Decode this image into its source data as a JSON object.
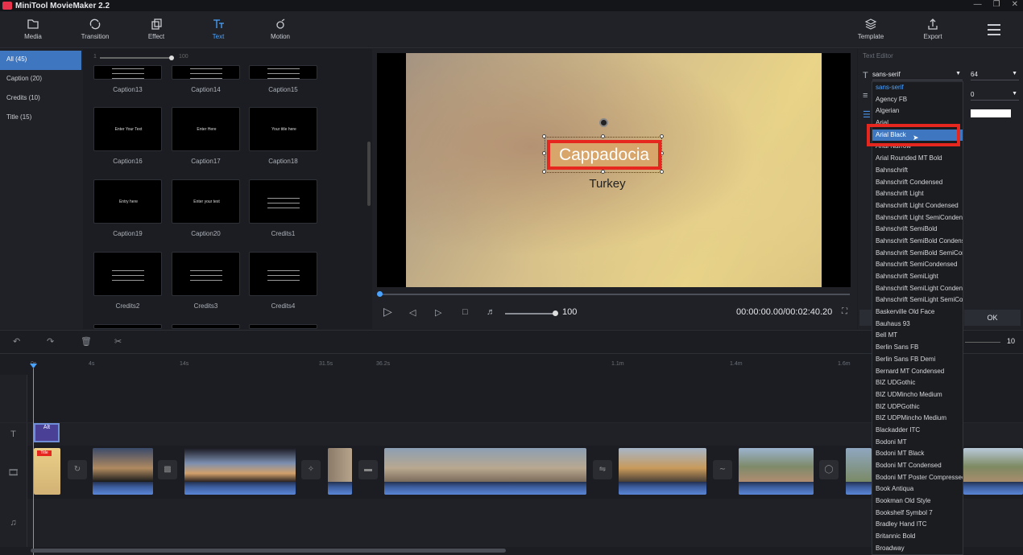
{
  "app": {
    "title": "MiniTool MovieMaker 2.2"
  },
  "toolbar": [
    {
      "label": "Media",
      "icon": "folder-icon"
    },
    {
      "label": "Transition",
      "icon": "transition-icon"
    },
    {
      "label": "Effect",
      "icon": "effect-icon"
    },
    {
      "label": "Text",
      "icon": "text-icon",
      "active": true
    },
    {
      "label": "Motion",
      "icon": "motion-icon"
    }
  ],
  "toolbar_right": [
    {
      "label": "Template",
      "icon": "template-icon"
    },
    {
      "label": "Export",
      "icon": "export-icon"
    }
  ],
  "categories": [
    {
      "label": "All (45)",
      "active": true
    },
    {
      "label": "Caption (20)"
    },
    {
      "label": "Credits (10)"
    },
    {
      "label": "Title (15)"
    }
  ],
  "library": {
    "slider_min": "1",
    "slider_max": "100",
    "rows": [
      [
        "Caption13",
        "Caption14",
        "Caption15"
      ],
      [
        "Caption16",
        "Caption17",
        "Caption18"
      ],
      [
        "Caption19",
        "Caption20",
        "Credits1"
      ],
      [
        "Credits2",
        "Credits3",
        "Credits4"
      ]
    ],
    "thumb_texts": [
      [
        "",
        "",
        ""
      ],
      [
        "Enter Your Text",
        "Enter Here",
        "Your title here"
      ],
      [
        "Entry here",
        "Enter your text",
        ""
      ],
      [
        "",
        "",
        ""
      ]
    ]
  },
  "preview": {
    "caption_text": "Cappadocia",
    "subtitle_text": "Turkey",
    "volume": "100",
    "timecode": "00:00:00.00/00:02:40.20"
  },
  "text_editor": {
    "title": "Text Editor",
    "font_value": "sans-serif",
    "size_value": "64",
    "spacing_value": "0",
    "ok_label": "OK",
    "text_color": "#ffffff"
  },
  "font_dropdown": [
    "sans-serif",
    "Agency FB",
    "Algerian",
    "Arial",
    "Arial Black",
    "Arial Narrow",
    "Arial Rounded MT Bold",
    "Bahnschrift",
    "Bahnschrift Condensed",
    "Bahnschrift Light",
    "Bahnschrift Light Condensed",
    "Bahnschrift Light SemiCondensed",
    "Bahnschrift SemiBold",
    "Bahnschrift SemiBold Condensed",
    "Bahnschrift SemiBold SemiCondensed",
    "Bahnschrift SemiCondensed",
    "Bahnschrift SemiLight",
    "Bahnschrift SemiLight Condensed",
    "Bahnschrift SemiLight SemiCondensed",
    "Baskerville Old Face",
    "Bauhaus 93",
    "Bell MT",
    "Berlin Sans FB",
    "Berlin Sans FB Demi",
    "Bernard MT Condensed",
    "BIZ UDGothic",
    "BIZ UDMincho Medium",
    "BIZ UDPGothic",
    "BIZ UDPMincho Medium",
    "Blackadder ITC",
    "Bodoni MT",
    "Bodoni MT Black",
    "Bodoni MT Condensed",
    "Bodoni MT Poster Compressed",
    "Book Antiqua",
    "Bookman Old Style",
    "Bookshelf Symbol 7",
    "Bradley Hand ITC",
    "Britannic Bold",
    "Broadway"
  ],
  "font_dropdown_selected": "Arial Black",
  "timeline": {
    "ruler": [
      "0s",
      "4s",
      "14s",
      "31.5s",
      "36.2s",
      "1.1m",
      "1.4m",
      "1.6m"
    ],
    "zoom_value": "10",
    "text_clip_label": "Alt",
    "title_clip_label": "Title"
  },
  "colors": {
    "accent": "#4aa3ff",
    "highlight": "#e5271f",
    "selected_bg": "#3f76c0"
  }
}
